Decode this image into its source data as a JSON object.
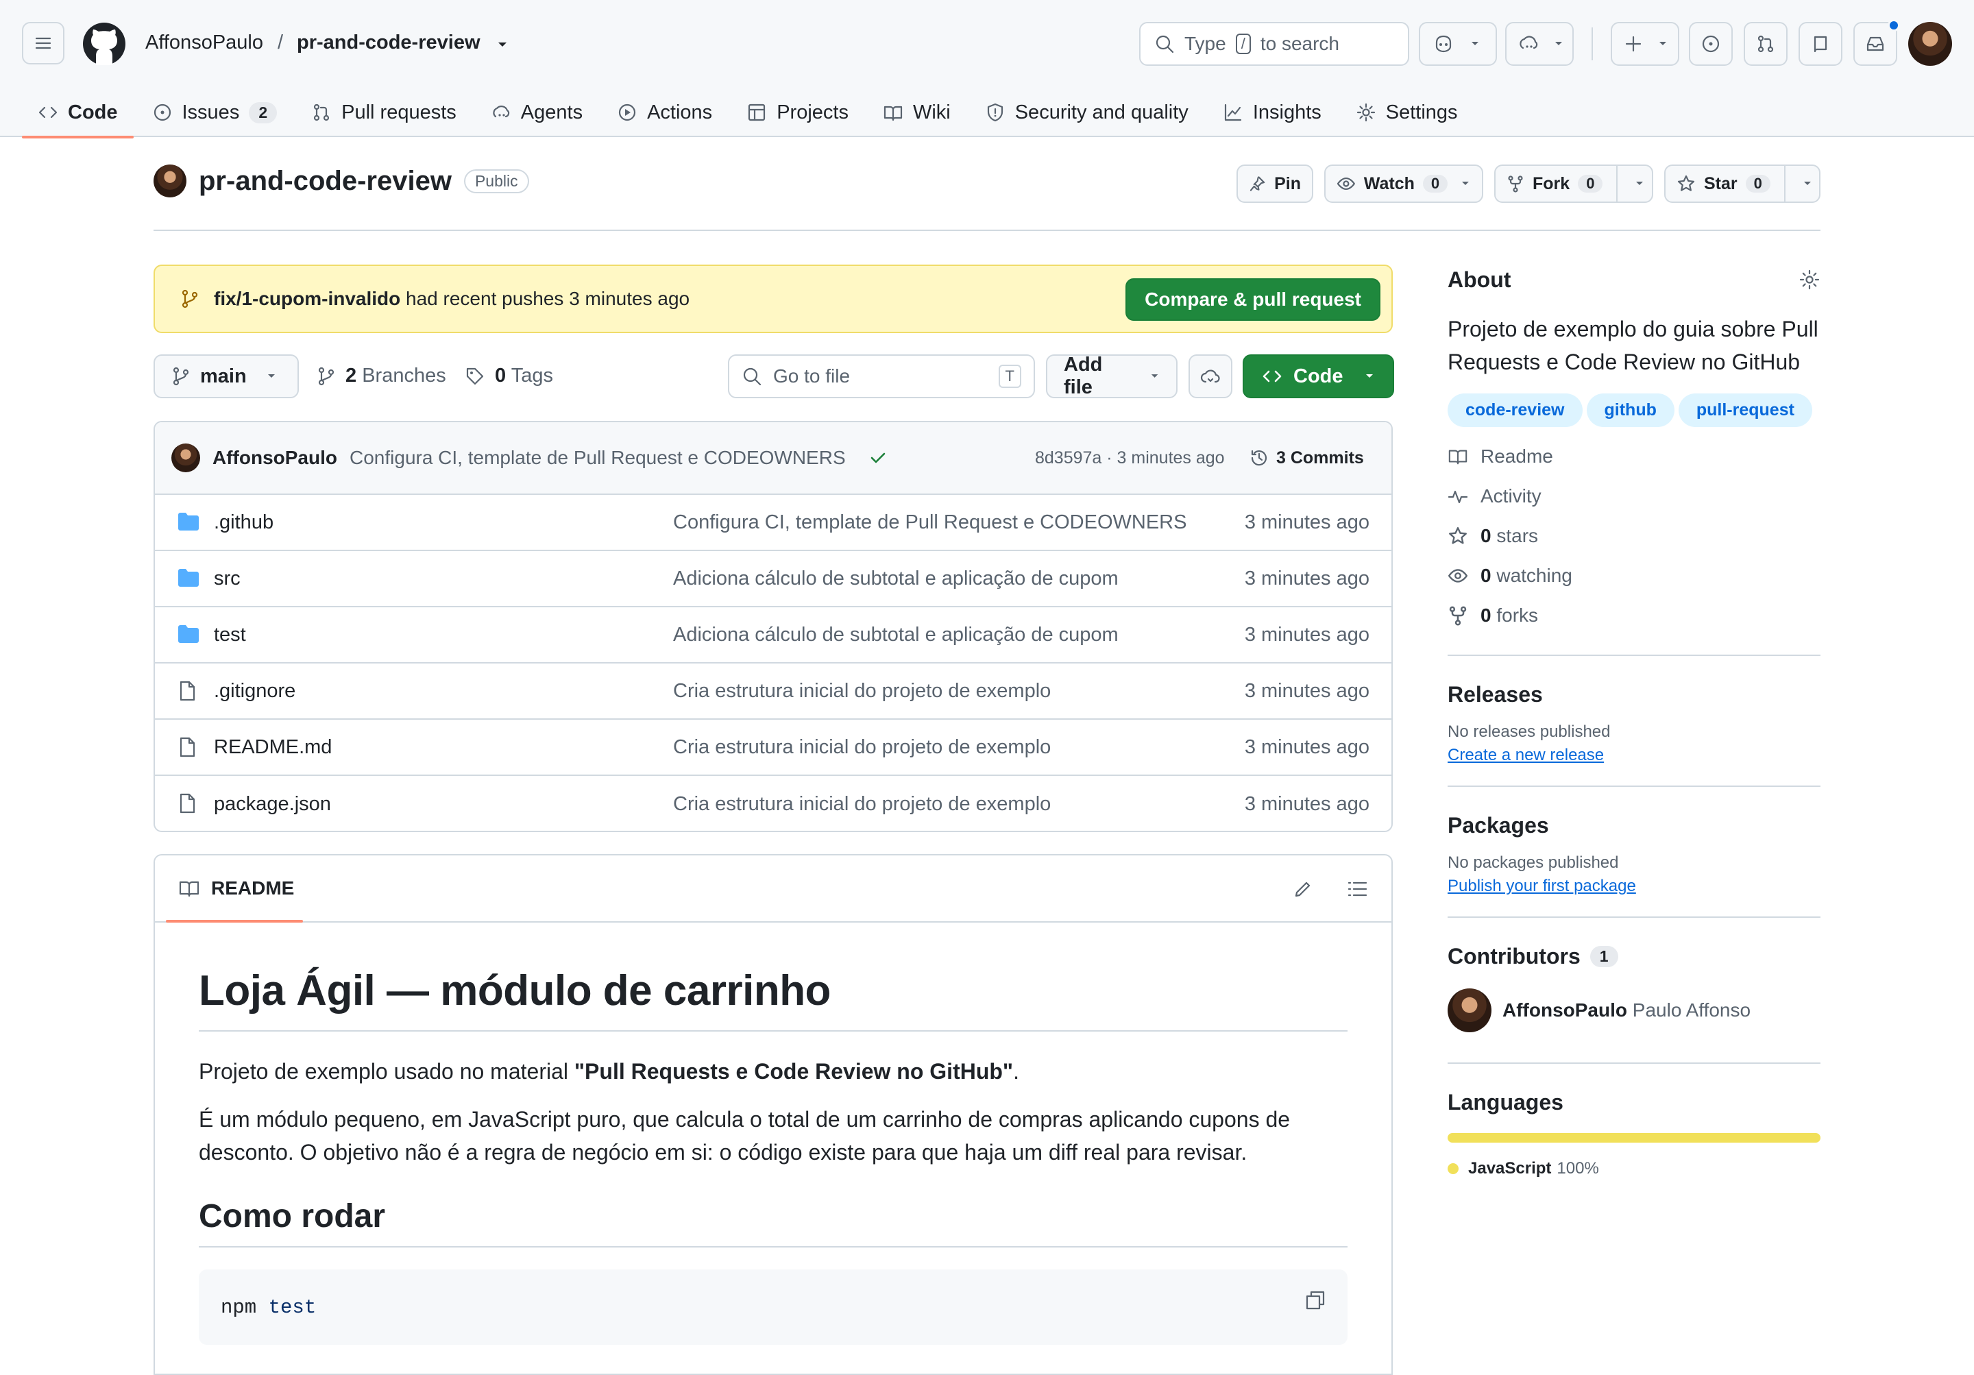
{
  "header": {
    "owner": "AffonsoPaulo",
    "separator": "/",
    "repo": "pr-and-code-review",
    "search_prefix": "Type",
    "search_key": "/",
    "search_suffix": "to search"
  },
  "tabs": [
    {
      "label": "Code",
      "icon": "code-icon",
      "active": true
    },
    {
      "label": "Issues",
      "icon": "issue-icon",
      "count": "2"
    },
    {
      "label": "Pull requests",
      "icon": "pull-request-icon"
    },
    {
      "label": "Agents",
      "icon": "agent-icon"
    },
    {
      "label": "Actions",
      "icon": "play-icon"
    },
    {
      "label": "Projects",
      "icon": "table-icon"
    },
    {
      "label": "Wiki",
      "icon": "book-icon"
    },
    {
      "label": "Security and quality",
      "icon": "shield-icon"
    },
    {
      "label": "Insights",
      "icon": "graph-icon"
    },
    {
      "label": "Settings",
      "icon": "gear-icon"
    }
  ],
  "repo": {
    "name": "pr-and-code-review",
    "visibility": "Public",
    "pin_label": "Pin",
    "watch_label": "Watch",
    "watch_count": "0",
    "fork_label": "Fork",
    "fork_count": "0",
    "star_label": "Star",
    "star_count": "0"
  },
  "banner": {
    "branch": "fix/1-cupom-invalido",
    "text": "had recent pushes 3 minutes ago",
    "button": "Compare & pull request"
  },
  "toolbar": {
    "branch": "main",
    "branches_count": "2",
    "branches_label": "Branches",
    "tags_count": "0",
    "tags_label": "Tags",
    "goto_placeholder": "Go to file",
    "goto_key": "T",
    "add_file": "Add file",
    "code_button": "Code"
  },
  "commit": {
    "author": "AffonsoPaulo",
    "message": "Configura CI, template de Pull Request e CODEOWNERS",
    "sha_time": "8d3597a · 3 minutes ago",
    "commits_label": "3 Commits"
  },
  "files": [
    {
      "name": ".github",
      "type": "folder",
      "message": "Configura CI, template de Pull Request e CODEOWNERS",
      "time": "3 minutes ago"
    },
    {
      "name": "src",
      "type": "folder",
      "message": "Adiciona cálculo de subtotal e aplicação de cupom",
      "time": "3 minutes ago"
    },
    {
      "name": "test",
      "type": "folder",
      "message": "Adiciona cálculo de subtotal e aplicação de cupom",
      "time": "3 minutes ago"
    },
    {
      "name": ".gitignore",
      "type": "file",
      "message": "Cria estrutura inicial do projeto de exemplo",
      "time": "3 minutes ago"
    },
    {
      "name": "README.md",
      "type": "file",
      "message": "Cria estrutura inicial do projeto de exemplo",
      "time": "3 minutes ago"
    },
    {
      "name": "package.json",
      "type": "file",
      "message": "Cria estrutura inicial do projeto de exemplo",
      "time": "3 minutes ago"
    }
  ],
  "readme": {
    "tab_label": "README",
    "h1": "Loja Ágil — módulo de carrinho",
    "p1_before": "Projeto de exemplo usado no material ",
    "p1_bold": "\"Pull Requests e Code Review no GitHub\"",
    "p1_after": ".",
    "p2": "É um módulo pequeno, em JavaScript puro, que calcula o total de um carrinho de compras aplicando cupons de desconto. O objetivo não é a regra de negócio em si: o código existe para que haja um diff real para revisar.",
    "h2": "Como rodar",
    "code_cmd": "npm",
    "code_arg": "test"
  },
  "about": {
    "title": "About",
    "description": "Projeto de exemplo do guia sobre Pull Requests e Code Review no GitHub",
    "topics": [
      "code-review",
      "github",
      "pull-request"
    ],
    "readme": "Readme",
    "activity": "Activity",
    "stars_count": "0",
    "stars_label": "stars",
    "watching_count": "0",
    "watching_label": "watching",
    "forks_count": "0",
    "forks_label": "forks"
  },
  "releases": {
    "title": "Releases",
    "empty": "No releases published",
    "link": "Create a new release"
  },
  "packages": {
    "title": "Packages",
    "empty": "No packages published",
    "link": "Publish your first package"
  },
  "contributors": {
    "title": "Contributors",
    "count": "1",
    "login": "AffonsoPaulo",
    "name": "Paulo Affonso"
  },
  "languages": {
    "title": "Languages",
    "name": "JavaScript",
    "percent": "100%",
    "share": 1.0,
    "color": "#f1e05a"
  },
  "colors": {
    "accent": "#0969da",
    "primary_button": "#1f883d",
    "tab_underline": "#fd8c73",
    "banner_bg": "#fff8c5",
    "folder": "#54aeff"
  }
}
